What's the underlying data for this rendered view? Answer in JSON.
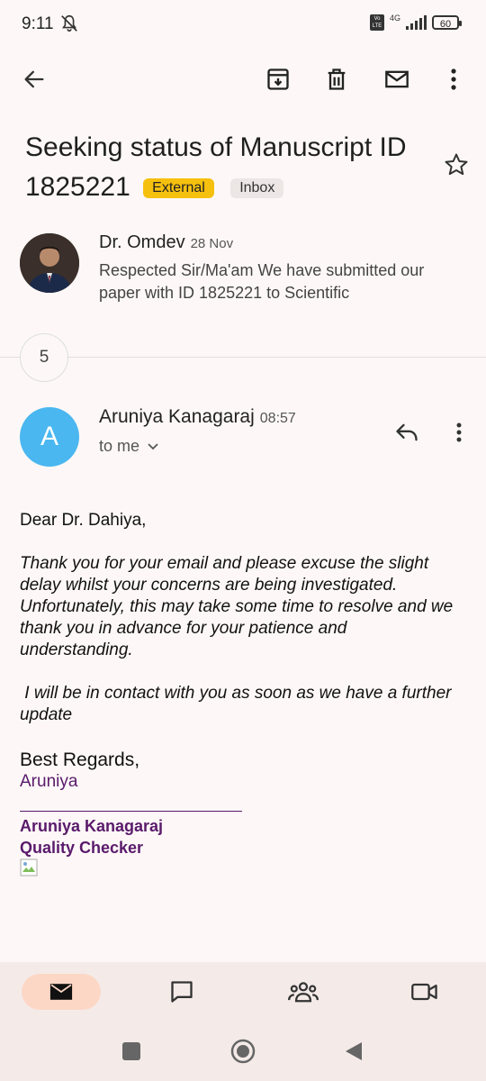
{
  "status_bar": {
    "time": "9:11",
    "network": "4G",
    "volte": "Vo LTE",
    "battery": "60"
  },
  "toolbar": {
    "back_icon": "arrow-left-icon",
    "archive_icon": "archive-icon",
    "delete_icon": "trash-icon",
    "mark_unread_icon": "mail-icon",
    "more_icon": "more-vert-icon"
  },
  "subject": {
    "title_line1": "Seeking status of Manuscript ID",
    "title_line2": "1825221",
    "label_external": "External",
    "label_inbox": "Inbox"
  },
  "thread": {
    "first_message": {
      "sender": "Dr. Omdev",
      "date": "28 Nov",
      "snippet": "Respected Sir/Ma'am We have submitted our paper with ID 1825221 to Scientific"
    },
    "collapsed_count": "5",
    "current_message": {
      "avatar_letter": "A",
      "sender": "Aruniya Kanagaraj",
      "time": "08:57",
      "to": "to me",
      "greeting": "Dear Dr. Dahiya,",
      "paragraph1": "Thank you for your email and please excuse the slight delay whilst your concerns are being investigated. Unfortunately, this may take some time to resolve and we thank you in advance for your patience and understanding.",
      "paragraph2": " I will be in contact with you as soon as we have a further update",
      "closing": "Best Regards,",
      "sign_name": "Aruniya",
      "signature_name": "Aruniya Kanagaraj",
      "signature_title": "Quality Checker"
    }
  },
  "bottom_nav": {
    "items": [
      "mail-icon",
      "chat-icon",
      "spaces-icon",
      "meet-icon"
    ]
  },
  "colors": {
    "background": "#fdf8f7",
    "external_chip": "#f6c00f",
    "avatar": "#4ab7f0",
    "signature": "#5a1a6b",
    "nav_active": "#fdd7c6"
  }
}
